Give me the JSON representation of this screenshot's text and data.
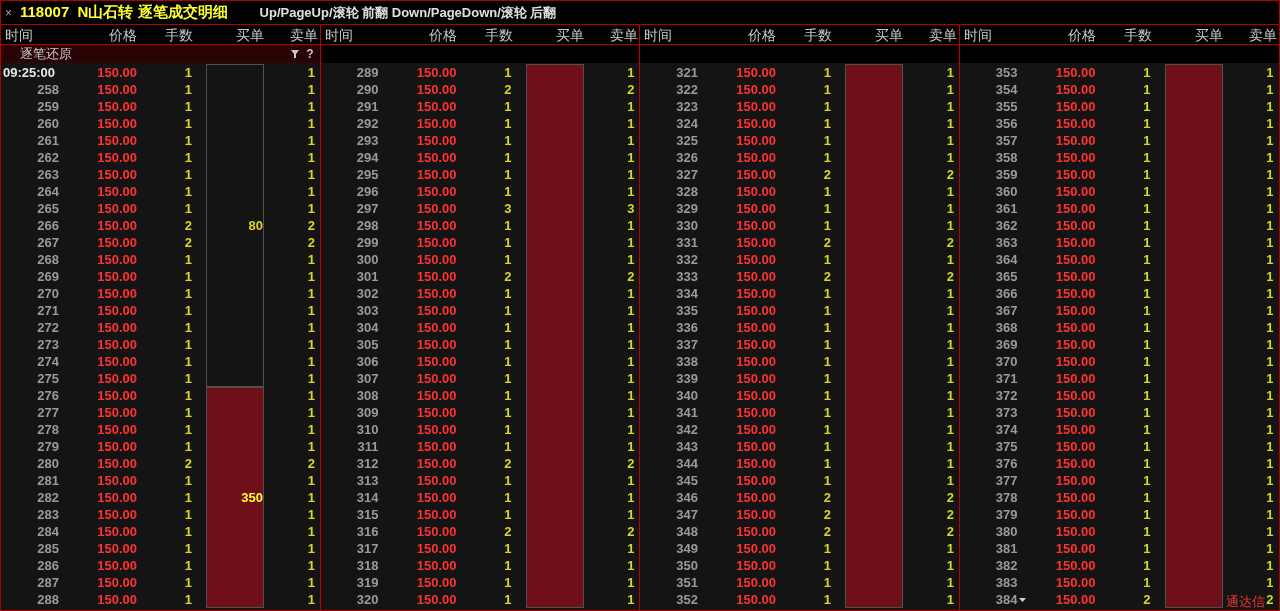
{
  "window": {
    "close": "×",
    "title": "118007  N山石转 逐笔成交明细",
    "hint": "Up/PageUp/滚轮 前翻 Down/PageDown/滚轮 后翻"
  },
  "subheader": {
    "label": "逐笔还原",
    "help": "?"
  },
  "panels": [
    {
      "columns": [
        "时间",
        "价格",
        "手数",
        "买单",
        "卖单"
      ],
      "rows": [
        {
          "kind": "timestamp",
          "time": "09:25:00",
          "price": "150.00",
          "lots": "1",
          "sell": "1",
          "buy_order": {
            "filled": false,
            "label": "80"
          }
        },
        {
          "kind": "seq",
          "time": "258",
          "price": "150.00",
          "lots": "1",
          "sell": "1"
        },
        {
          "kind": "seq",
          "time": "259",
          "price": "150.00",
          "lots": "1",
          "sell": "1"
        },
        {
          "kind": "seq",
          "time": "260",
          "price": "150.00",
          "lots": "1",
          "sell": "1"
        },
        {
          "kind": "seq",
          "time": "261",
          "price": "150.00",
          "lots": "1",
          "sell": "1"
        },
        {
          "kind": "seq",
          "time": "262",
          "price": "150.00",
          "lots": "1",
          "sell": "1"
        },
        {
          "kind": "seq",
          "time": "263",
          "price": "150.00",
          "lots": "1",
          "sell": "1"
        },
        {
          "kind": "seq",
          "time": "264",
          "price": "150.00",
          "lots": "1",
          "sell": "1"
        },
        {
          "kind": "seq",
          "time": "265",
          "price": "150.00",
          "lots": "1",
          "sell": "1"
        },
        {
          "kind": "seq",
          "time": "266",
          "price": "150.00",
          "lots": "2",
          "sell": "2"
        },
        {
          "kind": "seq",
          "time": "267",
          "price": "150.00",
          "lots": "2",
          "sell": "2"
        },
        {
          "kind": "seq",
          "time": "268",
          "price": "150.00",
          "lots": "1",
          "sell": "1"
        },
        {
          "kind": "seq",
          "time": "269",
          "price": "150.00",
          "lots": "1",
          "sell": "1"
        },
        {
          "kind": "seq",
          "time": "270",
          "price": "150.00",
          "lots": "1",
          "sell": "1"
        },
        {
          "kind": "seq",
          "time": "271",
          "price": "150.00",
          "lots": "1",
          "sell": "1"
        },
        {
          "kind": "seq",
          "time": "272",
          "price": "150.00",
          "lots": "1",
          "sell": "1"
        },
        {
          "kind": "seq",
          "time": "273",
          "price": "150.00",
          "lots": "1",
          "sell": "1"
        },
        {
          "kind": "seq",
          "time": "274",
          "price": "150.00",
          "lots": "1",
          "sell": "1"
        },
        {
          "kind": "seq",
          "time": "275",
          "price": "150.00",
          "lots": "1",
          "sell": "1"
        },
        {
          "kind": "seq",
          "time": "276",
          "price": "150.00",
          "lots": "1",
          "sell": "1",
          "buy_order": {
            "filled": true,
            "label": "350"
          }
        },
        {
          "kind": "seq",
          "time": "277",
          "price": "150.00",
          "lots": "1",
          "sell": "1"
        },
        {
          "kind": "seq",
          "time": "278",
          "price": "150.00",
          "lots": "1",
          "sell": "1"
        },
        {
          "kind": "seq",
          "time": "279",
          "price": "150.00",
          "lots": "1",
          "sell": "1"
        },
        {
          "kind": "seq",
          "time": "280",
          "price": "150.00",
          "lots": "2",
          "sell": "2"
        },
        {
          "kind": "seq",
          "time": "281",
          "price": "150.00",
          "lots": "1",
          "sell": "1"
        },
        {
          "kind": "seq",
          "time": "282",
          "price": "150.00",
          "lots": "1",
          "sell": "1"
        },
        {
          "kind": "seq",
          "time": "283",
          "price": "150.00",
          "lots": "1",
          "sell": "1"
        },
        {
          "kind": "seq",
          "time": "284",
          "price": "150.00",
          "lots": "1",
          "sell": "1"
        },
        {
          "kind": "seq",
          "time": "285",
          "price": "150.00",
          "lots": "1",
          "sell": "1"
        },
        {
          "kind": "seq",
          "time": "286",
          "price": "150.00",
          "lots": "1",
          "sell": "1"
        },
        {
          "kind": "seq",
          "time": "287",
          "price": "150.00",
          "lots": "1",
          "sell": "1"
        },
        {
          "kind": "seq",
          "time": "288",
          "price": "150.00",
          "lots": "1",
          "sell": "1"
        }
      ]
    },
    {
      "columns": [
        "时间",
        "价格",
        "手数",
        "买单",
        "卖单"
      ],
      "rows": [
        {
          "kind": "seq",
          "time": "289",
          "price": "150.00",
          "lots": "1",
          "sell": "1",
          "buy_order": {
            "filled": true
          }
        },
        {
          "kind": "seq",
          "time": "290",
          "price": "150.00",
          "lots": "2",
          "sell": "2"
        },
        {
          "kind": "seq",
          "time": "291",
          "price": "150.00",
          "lots": "1",
          "sell": "1"
        },
        {
          "kind": "seq",
          "time": "292",
          "price": "150.00",
          "lots": "1",
          "sell": "1"
        },
        {
          "kind": "seq",
          "time": "293",
          "price": "150.00",
          "lots": "1",
          "sell": "1"
        },
        {
          "kind": "seq",
          "time": "294",
          "price": "150.00",
          "lots": "1",
          "sell": "1"
        },
        {
          "kind": "seq",
          "time": "295",
          "price": "150.00",
          "lots": "1",
          "sell": "1"
        },
        {
          "kind": "seq",
          "time": "296",
          "price": "150.00",
          "lots": "1",
          "sell": "1"
        },
        {
          "kind": "seq",
          "time": "297",
          "price": "150.00",
          "lots": "3",
          "sell": "3"
        },
        {
          "kind": "seq",
          "time": "298",
          "price": "150.00",
          "lots": "1",
          "sell": "1"
        },
        {
          "kind": "seq",
          "time": "299",
          "price": "150.00",
          "lots": "1",
          "sell": "1"
        },
        {
          "kind": "seq",
          "time": "300",
          "price": "150.00",
          "lots": "1",
          "sell": "1"
        },
        {
          "kind": "seq",
          "time": "301",
          "price": "150.00",
          "lots": "2",
          "sell": "2"
        },
        {
          "kind": "seq",
          "time": "302",
          "price": "150.00",
          "lots": "1",
          "sell": "1"
        },
        {
          "kind": "seq",
          "time": "303",
          "price": "150.00",
          "lots": "1",
          "sell": "1"
        },
        {
          "kind": "seq",
          "time": "304",
          "price": "150.00",
          "lots": "1",
          "sell": "1"
        },
        {
          "kind": "seq",
          "time": "305",
          "price": "150.00",
          "lots": "1",
          "sell": "1"
        },
        {
          "kind": "seq",
          "time": "306",
          "price": "150.00",
          "lots": "1",
          "sell": "1"
        },
        {
          "kind": "seq",
          "time": "307",
          "price": "150.00",
          "lots": "1",
          "sell": "1"
        },
        {
          "kind": "seq",
          "time": "308",
          "price": "150.00",
          "lots": "1",
          "sell": "1"
        },
        {
          "kind": "seq",
          "time": "309",
          "price": "150.00",
          "lots": "1",
          "sell": "1"
        },
        {
          "kind": "seq",
          "time": "310",
          "price": "150.00",
          "lots": "1",
          "sell": "1"
        },
        {
          "kind": "seq",
          "time": "311",
          "price": "150.00",
          "lots": "1",
          "sell": "1"
        },
        {
          "kind": "seq",
          "time": "312",
          "price": "150.00",
          "lots": "2",
          "sell": "2"
        },
        {
          "kind": "seq",
          "time": "313",
          "price": "150.00",
          "lots": "1",
          "sell": "1"
        },
        {
          "kind": "seq",
          "time": "314",
          "price": "150.00",
          "lots": "1",
          "sell": "1"
        },
        {
          "kind": "seq",
          "time": "315",
          "price": "150.00",
          "lots": "1",
          "sell": "1"
        },
        {
          "kind": "seq",
          "time": "316",
          "price": "150.00",
          "lots": "2",
          "sell": "2"
        },
        {
          "kind": "seq",
          "time": "317",
          "price": "150.00",
          "lots": "1",
          "sell": "1"
        },
        {
          "kind": "seq",
          "time": "318",
          "price": "150.00",
          "lots": "1",
          "sell": "1"
        },
        {
          "kind": "seq",
          "time": "319",
          "price": "150.00",
          "lots": "1",
          "sell": "1"
        },
        {
          "kind": "seq",
          "time": "320",
          "price": "150.00",
          "lots": "1",
          "sell": "1"
        }
      ]
    },
    {
      "columns": [
        "时间",
        "价格",
        "手数",
        "买单",
        "卖单"
      ],
      "rows": [
        {
          "kind": "seq",
          "time": "321",
          "price": "150.00",
          "lots": "1",
          "sell": "1",
          "buy_order": {
            "filled": true
          }
        },
        {
          "kind": "seq",
          "time": "322",
          "price": "150.00",
          "lots": "1",
          "sell": "1"
        },
        {
          "kind": "seq",
          "time": "323",
          "price": "150.00",
          "lots": "1",
          "sell": "1"
        },
        {
          "kind": "seq",
          "time": "324",
          "price": "150.00",
          "lots": "1",
          "sell": "1"
        },
        {
          "kind": "seq",
          "time": "325",
          "price": "150.00",
          "lots": "1",
          "sell": "1"
        },
        {
          "kind": "seq",
          "time": "326",
          "price": "150.00",
          "lots": "1",
          "sell": "1"
        },
        {
          "kind": "seq",
          "time": "327",
          "price": "150.00",
          "lots": "2",
          "sell": "2"
        },
        {
          "kind": "seq",
          "time": "328",
          "price": "150.00",
          "lots": "1",
          "sell": "1"
        },
        {
          "kind": "seq",
          "time": "329",
          "price": "150.00",
          "lots": "1",
          "sell": "1"
        },
        {
          "kind": "seq",
          "time": "330",
          "price": "150.00",
          "lots": "1",
          "sell": "1"
        },
        {
          "kind": "seq",
          "time": "331",
          "price": "150.00",
          "lots": "2",
          "sell": "2"
        },
        {
          "kind": "seq",
          "time": "332",
          "price": "150.00",
          "lots": "1",
          "sell": "1"
        },
        {
          "kind": "seq",
          "time": "333",
          "price": "150.00",
          "lots": "2",
          "sell": "2"
        },
        {
          "kind": "seq",
          "time": "334",
          "price": "150.00",
          "lots": "1",
          "sell": "1"
        },
        {
          "kind": "seq",
          "time": "335",
          "price": "150.00",
          "lots": "1",
          "sell": "1"
        },
        {
          "kind": "seq",
          "time": "336",
          "price": "150.00",
          "lots": "1",
          "sell": "1"
        },
        {
          "kind": "seq",
          "time": "337",
          "price": "150.00",
          "lots": "1",
          "sell": "1"
        },
        {
          "kind": "seq",
          "time": "338",
          "price": "150.00",
          "lots": "1",
          "sell": "1"
        },
        {
          "kind": "seq",
          "time": "339",
          "price": "150.00",
          "lots": "1",
          "sell": "1"
        },
        {
          "kind": "seq",
          "time": "340",
          "price": "150.00",
          "lots": "1",
          "sell": "1"
        },
        {
          "kind": "seq",
          "time": "341",
          "price": "150.00",
          "lots": "1",
          "sell": "1"
        },
        {
          "kind": "seq",
          "time": "342",
          "price": "150.00",
          "lots": "1",
          "sell": "1"
        },
        {
          "kind": "seq",
          "time": "343",
          "price": "150.00",
          "lots": "1",
          "sell": "1"
        },
        {
          "kind": "seq",
          "time": "344",
          "price": "150.00",
          "lots": "1",
          "sell": "1"
        },
        {
          "kind": "seq",
          "time": "345",
          "price": "150.00",
          "lots": "1",
          "sell": "1"
        },
        {
          "kind": "seq",
          "time": "346",
          "price": "150.00",
          "lots": "2",
          "sell": "2"
        },
        {
          "kind": "seq",
          "time": "347",
          "price": "150.00",
          "lots": "2",
          "sell": "2"
        },
        {
          "kind": "seq",
          "time": "348",
          "price": "150.00",
          "lots": "2",
          "sell": "2"
        },
        {
          "kind": "seq",
          "time": "349",
          "price": "150.00",
          "lots": "1",
          "sell": "1"
        },
        {
          "kind": "seq",
          "time": "350",
          "price": "150.00",
          "lots": "1",
          "sell": "1"
        },
        {
          "kind": "seq",
          "time": "351",
          "price": "150.00",
          "lots": "1",
          "sell": "1"
        },
        {
          "kind": "seq",
          "time": "352",
          "price": "150.00",
          "lots": "1",
          "sell": "1"
        }
      ]
    },
    {
      "columns": [
        "时间",
        "价格",
        "手数",
        "买单",
        "卖单"
      ],
      "rows": [
        {
          "kind": "seq",
          "time": "353",
          "price": "150.00",
          "lots": "1",
          "sell": "1",
          "buy_order": {
            "filled": true
          }
        },
        {
          "kind": "seq",
          "time": "354",
          "price": "150.00",
          "lots": "1",
          "sell": "1"
        },
        {
          "kind": "seq",
          "time": "355",
          "price": "150.00",
          "lots": "1",
          "sell": "1"
        },
        {
          "kind": "seq",
          "time": "356",
          "price": "150.00",
          "lots": "1",
          "sell": "1"
        },
        {
          "kind": "seq",
          "time": "357",
          "price": "150.00",
          "lots": "1",
          "sell": "1"
        },
        {
          "kind": "seq",
          "time": "358",
          "price": "150.00",
          "lots": "1",
          "sell": "1"
        },
        {
          "kind": "seq",
          "time": "359",
          "price": "150.00",
          "lots": "1",
          "sell": "1"
        },
        {
          "kind": "seq",
          "time": "360",
          "price": "150.00",
          "lots": "1",
          "sell": "1"
        },
        {
          "kind": "seq",
          "time": "361",
          "price": "150.00",
          "lots": "1",
          "sell": "1"
        },
        {
          "kind": "seq",
          "time": "362",
          "price": "150.00",
          "lots": "1",
          "sell": "1"
        },
        {
          "kind": "seq",
          "time": "363",
          "price": "150.00",
          "lots": "1",
          "sell": "1"
        },
        {
          "kind": "seq",
          "time": "364",
          "price": "150.00",
          "lots": "1",
          "sell": "1"
        },
        {
          "kind": "seq",
          "time": "365",
          "price": "150.00",
          "lots": "1",
          "sell": "1"
        },
        {
          "kind": "seq",
          "time": "366",
          "price": "150.00",
          "lots": "1",
          "sell": "1"
        },
        {
          "kind": "seq",
          "time": "367",
          "price": "150.00",
          "lots": "1",
          "sell": "1"
        },
        {
          "kind": "seq",
          "time": "368",
          "price": "150.00",
          "lots": "1",
          "sell": "1"
        },
        {
          "kind": "seq",
          "time": "369",
          "price": "150.00",
          "lots": "1",
          "sell": "1"
        },
        {
          "kind": "seq",
          "time": "370",
          "price": "150.00",
          "lots": "1",
          "sell": "1"
        },
        {
          "kind": "seq",
          "time": "371",
          "price": "150.00",
          "lots": "1",
          "sell": "1"
        },
        {
          "kind": "seq",
          "time": "372",
          "price": "150.00",
          "lots": "1",
          "sell": "1"
        },
        {
          "kind": "seq",
          "time": "373",
          "price": "150.00",
          "lots": "1",
          "sell": "1"
        },
        {
          "kind": "seq",
          "time": "374",
          "price": "150.00",
          "lots": "1",
          "sell": "1"
        },
        {
          "kind": "seq",
          "time": "375",
          "price": "150.00",
          "lots": "1",
          "sell": "1"
        },
        {
          "kind": "seq",
          "time": "376",
          "price": "150.00",
          "lots": "1",
          "sell": "1"
        },
        {
          "kind": "seq",
          "time": "377",
          "price": "150.00",
          "lots": "1",
          "sell": "1"
        },
        {
          "kind": "seq",
          "time": "378",
          "price": "150.00",
          "lots": "1",
          "sell": "1"
        },
        {
          "kind": "seq",
          "time": "379",
          "price": "150.00",
          "lots": "1",
          "sell": "1"
        },
        {
          "kind": "seq",
          "time": "380",
          "price": "150.00",
          "lots": "1",
          "sell": "1"
        },
        {
          "kind": "seq",
          "time": "381",
          "price": "150.00",
          "lots": "1",
          "sell": "1"
        },
        {
          "kind": "seq",
          "time": "382",
          "price": "150.00",
          "lots": "1",
          "sell": "1"
        },
        {
          "kind": "seq",
          "time": "383",
          "price": "150.00",
          "lots": "1",
          "sell": "1"
        },
        {
          "kind": "seq",
          "time": "384",
          "price": "150.00",
          "lots": "2",
          "sell": "2",
          "marker": true
        }
      ]
    }
  ],
  "watermark_label": "通达信"
}
